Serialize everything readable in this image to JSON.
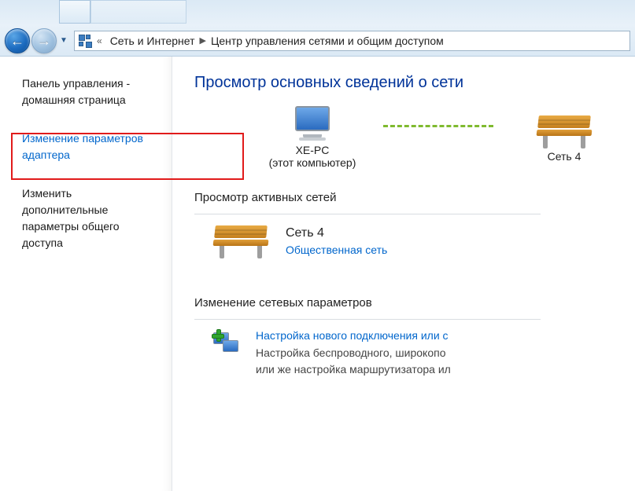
{
  "breadcrumb": {
    "item1": "Сеть и Интернет",
    "item2": "Центр управления сетями и общим доступом"
  },
  "sidebar": {
    "home": "Панель управления - домашняя страница",
    "adapter": "Изменение параметров адаптера",
    "sharing": "Изменить дополнительные параметры общего доступа"
  },
  "main": {
    "title": "Просмотр основных сведений о сети",
    "pc_name": "XE-PC",
    "pc_sub": "(этот компьютер)",
    "net_name_short": "Сеть  4",
    "active_head": "Просмотр активных сетей",
    "active_name": "Сеть  4",
    "active_type": "Общественная сеть",
    "params_head": "Изменение сетевых параметров",
    "new_conn_link": "Настройка нового подключения или с",
    "new_conn_desc1": "Настройка беспроводного, широкопо",
    "new_conn_desc2": "или же настройка маршрутизатора ил"
  }
}
